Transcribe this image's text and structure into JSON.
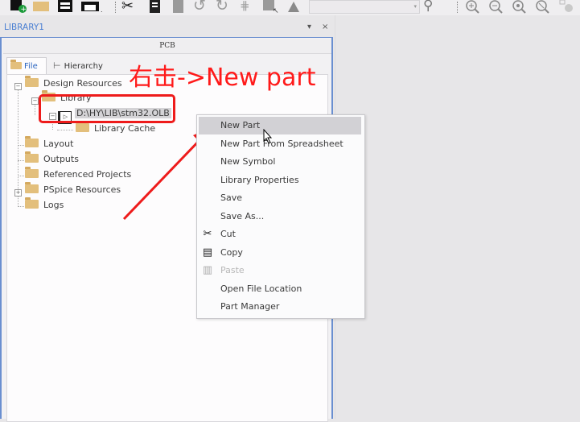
{
  "toolbar": {
    "icons": [
      "new-project-icon",
      "open-folder-icon",
      "save-icon",
      "print-icon",
      "cut-icon",
      "copy-icon",
      "paste-icon",
      "undo-icon",
      "redo-icon",
      "place-part-icon",
      "select-area-icon",
      "drc-warning-icon",
      "search-icon",
      "zoom-in-icon",
      "zoom-out-icon",
      "zoom-fit-icon",
      "zoom-area-icon",
      "zoom-all-icon"
    ],
    "search_combo_value": ""
  },
  "library_panel": {
    "title": "LIBRARY1",
    "pin_label": "▾",
    "close_label": "×",
    "header": "PCB",
    "tabs": [
      {
        "label": "File",
        "active": true
      },
      {
        "label": "Hierarchy",
        "active": false
      }
    ]
  },
  "tree": {
    "design_resources": "Design Resources",
    "library": "Library",
    "olb_file": "D:\\HY\\LIB\\stm32.OLB",
    "library_cache": "Library Cache",
    "layout": "Layout",
    "outputs": "Outputs",
    "referenced_projects": "Referenced Projects",
    "pspice_resources": "PSpice Resources",
    "logs": "Logs"
  },
  "annotation": {
    "text": "右击->New part",
    "color": "#ff1a1a"
  },
  "context_menu": {
    "items": [
      {
        "label": "New Part",
        "hover": true,
        "icon": ""
      },
      {
        "label": "New Part From Spreadsheet",
        "icon": ""
      },
      {
        "label": "New Symbol",
        "icon": ""
      },
      {
        "label": "Library Properties",
        "icon": ""
      },
      {
        "label": "Save",
        "icon": ""
      },
      {
        "label": "Save As...",
        "icon": ""
      },
      {
        "label": "Cut",
        "icon": "✂"
      },
      {
        "label": "Copy",
        "icon": "▤"
      },
      {
        "label": "Paste",
        "icon": "▥",
        "disabled": true
      },
      {
        "label": "Open File Location",
        "icon": ""
      },
      {
        "label": "Part Manager",
        "icon": ""
      }
    ]
  }
}
